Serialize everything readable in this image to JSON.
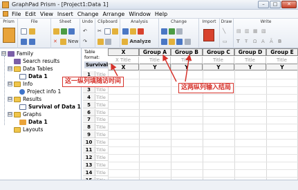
{
  "window": {
    "title": "GraphPad Prism - [Project1:Data 1]",
    "min": "–",
    "max": "□",
    "close": "✕"
  },
  "menu": [
    "File",
    "Edit",
    "View",
    "Insert",
    "Change",
    "Arrange",
    "Window",
    "Help"
  ],
  "toolbar": {
    "groups": [
      "Prism",
      "File",
      "Sheet",
      "Undo",
      "Clipboard",
      "Analysis",
      "Change",
      "Import",
      "Draw",
      "Write"
    ],
    "new_label": "New",
    "analyze_label": "Analyze"
  },
  "navigator": {
    "items": [
      {
        "label": "Family",
        "level": 0,
        "expander": "⊟",
        "icon": "family-icon"
      },
      {
        "label": "Search results",
        "level": 1,
        "icon": "search-results-icon"
      },
      {
        "label": "Data Tables",
        "level": 1,
        "expander": "⊟",
        "icon": "folder-icon"
      },
      {
        "label": "Data 1",
        "level": 2,
        "icon": "data-table-icon",
        "bold": true
      },
      {
        "label": "Info",
        "level": 1,
        "expander": "⊟",
        "icon": "folder-icon"
      },
      {
        "label": "Project info 1",
        "level": 2,
        "icon": "info-icon"
      },
      {
        "label": "Results",
        "level": 1,
        "expander": "⊟",
        "icon": "folder-icon"
      },
      {
        "label": "Survival of Data 1",
        "level": 2,
        "icon": "results-icon",
        "bold": true
      },
      {
        "label": "Graphs",
        "level": 1,
        "expander": "⊟",
        "icon": "folder-icon"
      },
      {
        "label": "Data 1",
        "level": 2,
        "icon": "graph-icon",
        "bold": true
      },
      {
        "label": "Layouts",
        "level": 1,
        "icon": "folder-icon"
      }
    ]
  },
  "sheet": {
    "table_format_label": "Table format:",
    "table_format_value": "Survival",
    "columns": [
      {
        "header": "X",
        "title": "X Title",
        "sub": "X"
      },
      {
        "header": "Group A",
        "title": "Title",
        "sub": "Y"
      },
      {
        "header": "Group B",
        "title": "Title",
        "sub": "Y"
      },
      {
        "header": "Group C",
        "title": "Title",
        "sub": "Y"
      },
      {
        "header": "Group D",
        "title": "Title",
        "sub": "Y"
      },
      {
        "header": "Group E",
        "title": "Title",
        "sub": "Y"
      }
    ],
    "row_title_placeholder": "Title",
    "rows": [
      "1",
      "2",
      "3",
      "4",
      "5",
      "6",
      "7",
      "8",
      "9",
      "10",
      "11",
      "12",
      "13",
      "14",
      "15"
    ]
  },
  "annotations": {
    "left": "这一纵列填随访时间",
    "right": "这两纵列输入结局",
    "color": "#d6312a"
  }
}
